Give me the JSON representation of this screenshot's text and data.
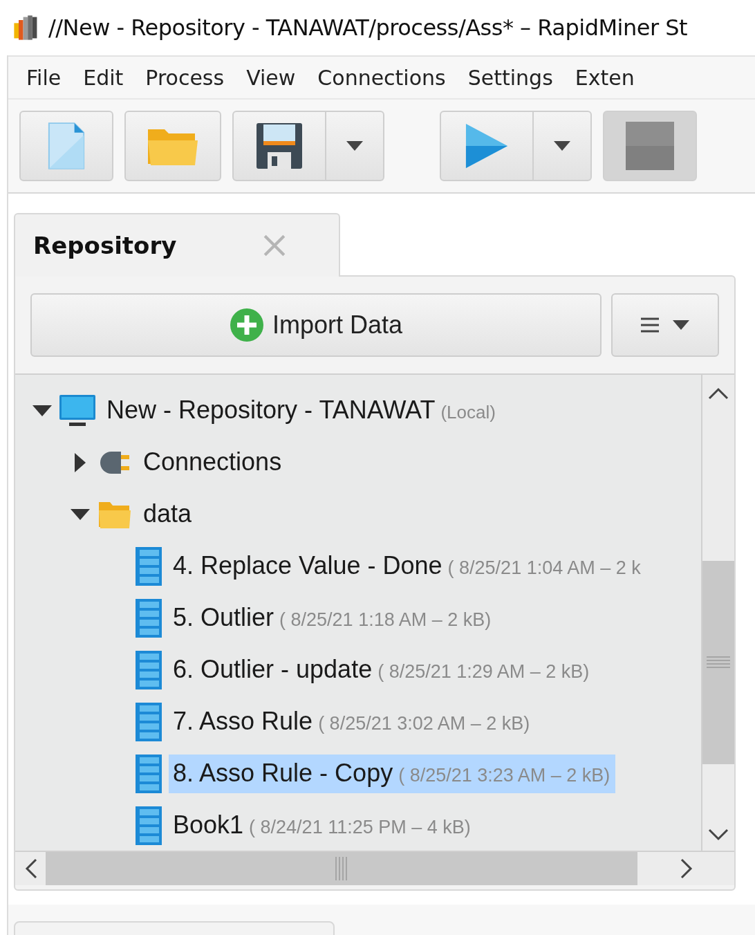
{
  "window": {
    "title": "//New - Repository - TANAWAT/process/Ass* – RapidMiner St"
  },
  "menu": [
    "File",
    "Edit",
    "Process",
    "View",
    "Connections",
    "Settings",
    "Exten"
  ],
  "toolbar": [
    {
      "kind": "new",
      "disabled": false
    },
    {
      "kind": "open",
      "disabled": false
    },
    {
      "kind": "save",
      "disabled": false,
      "dropdown": true
    },
    {
      "kind": "run",
      "disabled": false,
      "dropdown": true
    },
    {
      "kind": "stop",
      "disabled": true
    }
  ],
  "panel": {
    "tab": {
      "label": "Repository",
      "selected": true
    },
    "import_button": "Import Data",
    "tree": [
      {
        "kind": "repository",
        "name": "New - Repository - TANAWAT",
        "meta": "(Local)",
        "expanded": true,
        "selected": false,
        "children": [
          {
            "kind": "connections",
            "name": "Connections",
            "expanded": false,
            "selected": false
          },
          {
            "kind": "folder",
            "name": "data",
            "expanded": true,
            "selected": false,
            "children": [
              {
                "kind": "data",
                "name": "4. Replace Value - Done",
                "meta": "( 8/25/21 1:04 AM – 2 k",
                "selected": false
              },
              {
                "kind": "data",
                "name": "5. Outlier",
                "meta": "( 8/25/21 1:18 AM – 2 kB)",
                "selected": false
              },
              {
                "kind": "data",
                "name": "6. Outlier - update",
                "meta": "( 8/25/21 1:29 AM – 2 kB)",
                "selected": false
              },
              {
                "kind": "data",
                "name": "7. Asso Rule",
                "meta": "( 8/25/21 3:02 AM – 2 kB)",
                "selected": false
              },
              {
                "kind": "data",
                "name": "8. Asso Rule - Copy",
                "meta": "( 8/25/21 3:23 AM – 2 kB)",
                "selected": true
              },
              {
                "kind": "data",
                "name": "Book1",
                "meta": "( 8/24/21 11:25 PM – 4 kB)",
                "selected": false
              }
            ]
          }
        ]
      }
    ]
  }
}
